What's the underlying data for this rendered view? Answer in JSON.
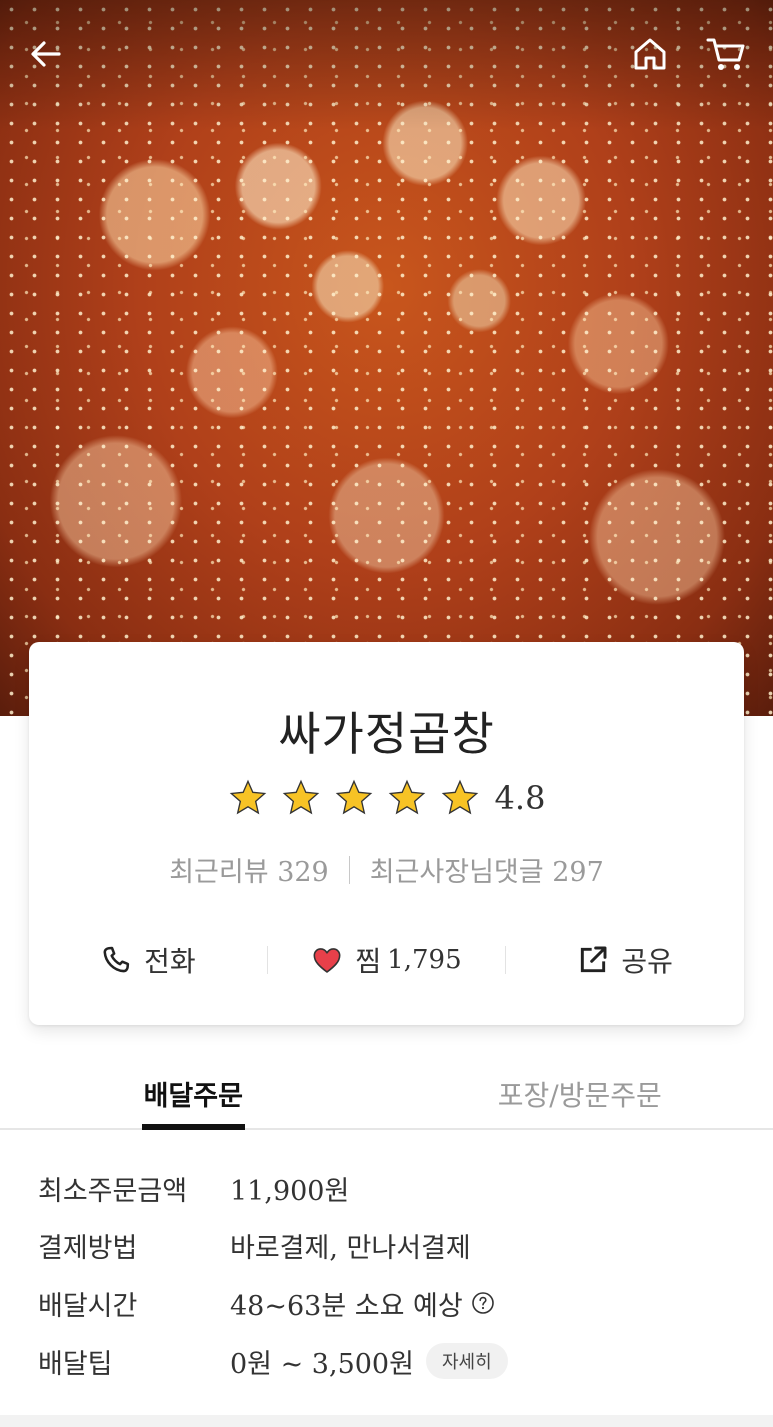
{
  "header": {
    "back_icon": "arrow-left-icon",
    "home_icon": "home-icon",
    "cart_icon": "cart-icon"
  },
  "store": {
    "name": "싸가정곱창",
    "rating": "4.8",
    "rating_stars": 5,
    "recent_reviews_label": "최근리뷰",
    "recent_reviews_count": "329",
    "owner_replies_label": "최근사장님댓글",
    "owner_replies_count": "297"
  },
  "actions": {
    "call_label": "전화",
    "like_label": "찜",
    "like_count": "1,795",
    "share_label": "공유"
  },
  "tabs": [
    {
      "label": "배달주문",
      "active": true
    },
    {
      "label": "포장/방문주문",
      "active": false
    }
  ],
  "info": {
    "min_order_label": "최소주문금액",
    "min_order_value": "11,900원",
    "payment_label": "결제방법",
    "payment_value": "바로결제, 만나서결제",
    "delivery_time_label": "배달시간",
    "delivery_time_value": "48~63분 소요 예상",
    "delivery_tip_label": "배달팁",
    "delivery_tip_value": "0원 ~ 3,500원",
    "detail_button": "자세히"
  },
  "colors": {
    "star": "#F7C325",
    "heart": "#E8404A",
    "text": "#222222",
    "muted": "#9A9A9A"
  }
}
